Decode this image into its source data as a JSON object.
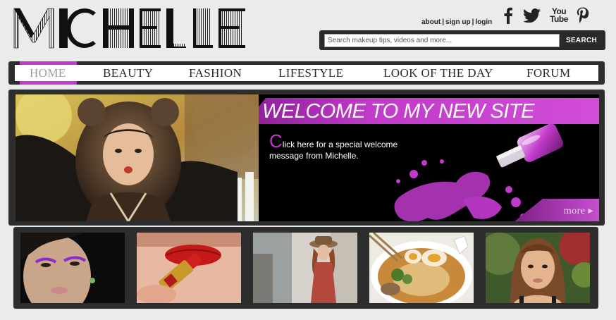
{
  "site": {
    "logo_text": "MICHELLE"
  },
  "top_links": {
    "about": "about",
    "sign_up": "sign up",
    "login": "login",
    "separator": "|"
  },
  "social": {
    "facebook": "facebook-icon",
    "twitter": "twitter-icon",
    "youtube_line1": "You",
    "youtube_line2": "Tube",
    "pinterest": "pinterest-icon"
  },
  "search": {
    "placeholder": "Search makeup tips, videos and more...",
    "button_label": "SEARCH"
  },
  "nav": {
    "items": [
      {
        "label": "HOME",
        "active": true
      },
      {
        "label": "BEAUTY",
        "active": false
      },
      {
        "label": "FASHION",
        "active": false
      },
      {
        "label": "LIFESTYLE",
        "active": false
      },
      {
        "label": "LOOK OF THE DAY",
        "active": false
      },
      {
        "label": "FORUM",
        "active": false
      }
    ]
  },
  "banner": {
    "headline": "WELCOME TO MY NEW SITE",
    "promo_initial": "C",
    "promo_rest": "lick here for a special welcome message from Michelle.",
    "more_label": "more"
  },
  "thumbnails": [
    {
      "subject": "purple eyeliner makeup look"
    },
    {
      "subject": "red lipstick"
    },
    {
      "subject": "woman in hat and dress"
    },
    {
      "subject": "ramen bowl"
    },
    {
      "subject": "portrait"
    }
  ],
  "colors": {
    "accent": "#c13acb",
    "dark": "#2d2d2d",
    "background": "#ebebeb"
  }
}
